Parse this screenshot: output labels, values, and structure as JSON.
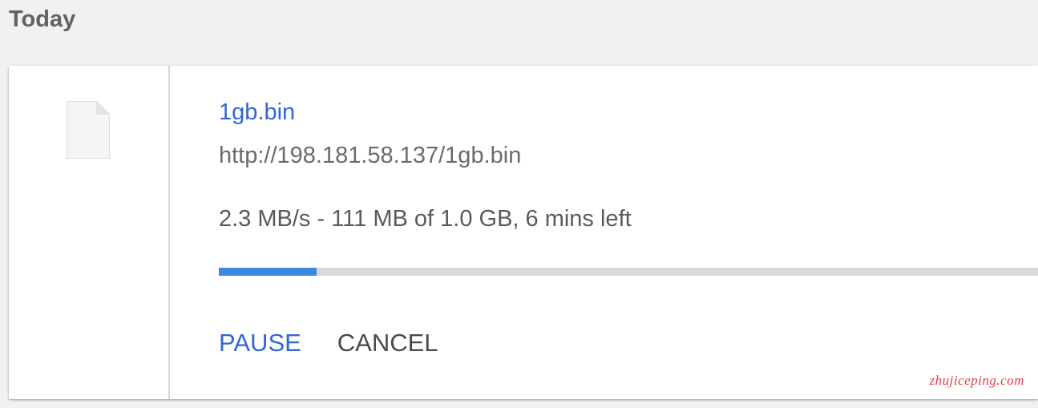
{
  "section": {
    "header": "Today"
  },
  "download": {
    "icon": "generic-file-icon",
    "file_name": "1gb.bin",
    "url": "http://198.181.58.137/1gb.bin",
    "status": "2.3 MB/s - 111 MB of 1.0 GB, 6 mins left",
    "progress_fraction": 0.1192,
    "actions": {
      "pause_label": "PAUSE",
      "cancel_label": "CANCEL"
    }
  },
  "watermark": {
    "text": "zhujiceping.com"
  },
  "colors": {
    "background": "#f1f1f1",
    "link_blue": "#3367d6",
    "progress_blue": "#3f86e3",
    "progress_track": "#d9d9d9",
    "watermark_red": "#e0404a"
  }
}
